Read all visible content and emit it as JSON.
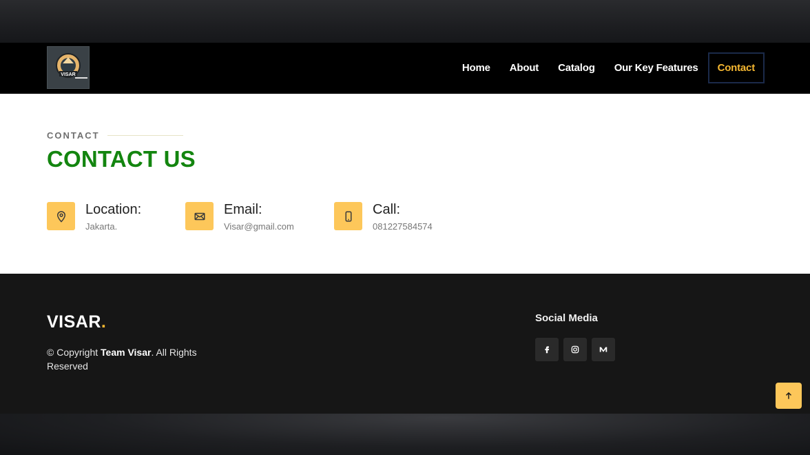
{
  "header": {
    "logo_text": "VISAR",
    "nav": [
      {
        "label": "Home"
      },
      {
        "label": "About"
      },
      {
        "label": "Catalog"
      },
      {
        "label": "Our Key Features"
      },
      {
        "label": "Contact"
      }
    ],
    "active_nav": "Contact"
  },
  "contact": {
    "eyebrow": "CONTACT",
    "heading": "CONTACT US",
    "items": [
      {
        "icon": "location-pin-icon",
        "title": "Location:",
        "value": "Jakarta."
      },
      {
        "icon": "envelope-icon",
        "title": "Email:",
        "value": "Visar@gmail.com"
      },
      {
        "icon": "phone-icon",
        "title": "Call:",
        "value": "081227584574"
      }
    ]
  },
  "footer": {
    "brand": "VISAR",
    "brand_dot": ".",
    "copyright_prefix": "© Copyright ",
    "copyright_team": "Team Visar",
    "copyright_suffix": ". All Rights Reserved",
    "social_title": "Social Media",
    "social": [
      {
        "icon": "facebook-icon"
      },
      {
        "icon": "instagram-icon"
      },
      {
        "icon": "medium-icon"
      }
    ]
  },
  "colors": {
    "accent": "#f5b731",
    "icon_bg": "#fdc75a",
    "heading_green": "#13850f",
    "header_bg": "#000000",
    "footer_bg": "#161616"
  }
}
